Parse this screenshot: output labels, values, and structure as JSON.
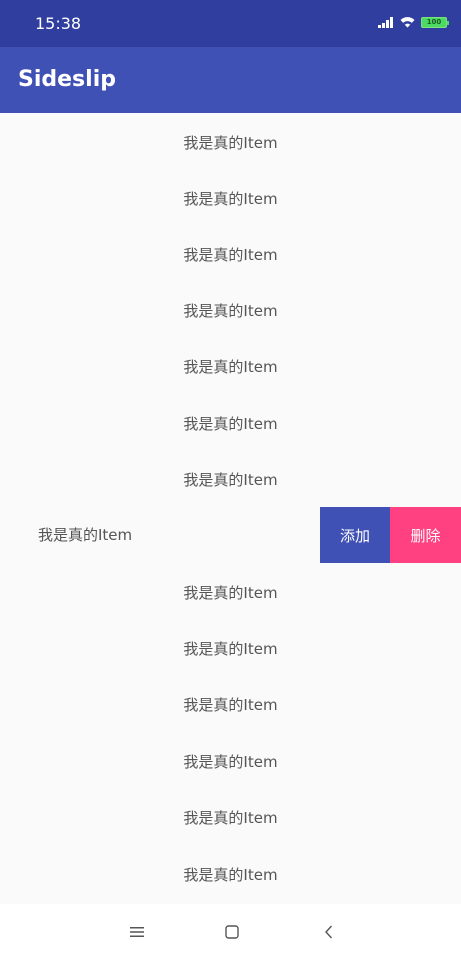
{
  "status_bar": {
    "time": "15:38",
    "battery": "100",
    "icons": [
      "signal-icon",
      "wifi-icon",
      "battery-icon"
    ]
  },
  "app_bar": {
    "title": "Sideslip",
    "color": "#3f51b5"
  },
  "list": {
    "items": [
      "我是真的Item",
      "我是真的Item",
      "我是真的Item",
      "我是真的Item",
      "我是真的Item",
      "我是真的Item",
      "我是真的Item",
      "我是真的Item",
      "我是真的Item",
      "我是真的Item",
      "我是真的Item",
      "我是真的Item",
      "我是真的Item",
      "我是真的Item"
    ],
    "swiped_item": {
      "label": "我是真的Item",
      "add_label": "添加",
      "delete_label": "删除",
      "add_color": "#3f51b5",
      "delete_color": "#ff4081"
    }
  },
  "nav_bar": {
    "icons": [
      "menu-icon",
      "home-icon",
      "back-icon"
    ]
  }
}
